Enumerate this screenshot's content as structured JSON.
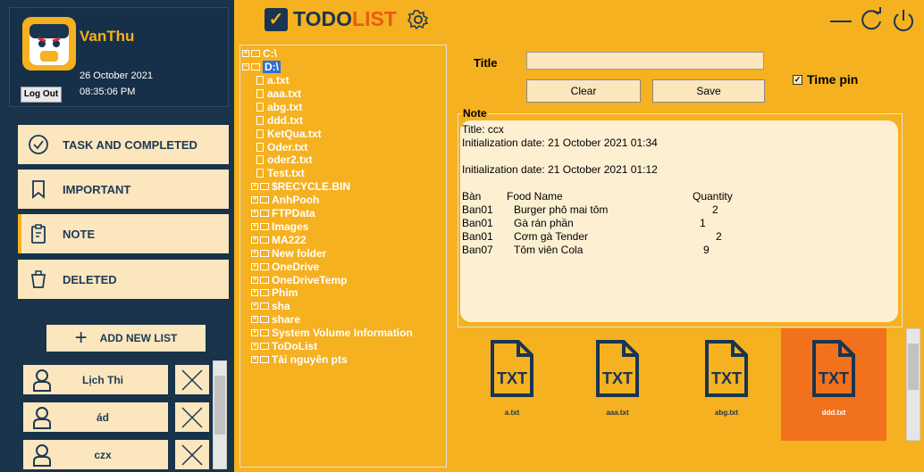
{
  "user": {
    "name": "VanThu",
    "date": "26 October 2021",
    "time": "08:35:06 PM",
    "logout_label": "Log Out"
  },
  "nav": [
    {
      "label": "TASK AND COMPLETED",
      "icon": "check-circle-icon"
    },
    {
      "label": "IMPORTANT",
      "icon": "bookmark-icon"
    },
    {
      "label": "NOTE",
      "icon": "clipboard-icon"
    },
    {
      "label": "DELETED",
      "icon": "trash-icon"
    }
  ],
  "add_list_label": "ADD NEW LIST",
  "lists": [
    {
      "name": "Lịch Thi"
    },
    {
      "name": "ád"
    },
    {
      "name": "czx"
    }
  ],
  "app": {
    "logo_part1": "TODO",
    "logo_part2": "LIST",
    "brand_color": "#f5b120",
    "accent_color": "#f2711c",
    "dark_color": "#1a3550"
  },
  "tree": {
    "c_drive": "C:\\",
    "d_drive": "D:\\",
    "files": [
      "a.txt",
      "aaa.txt",
      "abg.txt",
      "ddd.txt",
      "KetQua.txt",
      "Oder.txt",
      "oder2.txt",
      "Test.txt"
    ],
    "folders": [
      "$RECYCLE.BIN",
      "AnhPooh",
      "FTPData",
      "Images",
      "MA222",
      "New folder",
      "OneDrive",
      "OneDriveTemp",
      "Phim",
      "sha",
      "share",
      "System Volume Information",
      "ToDoList",
      "Tài nguyên pts"
    ]
  },
  "editor": {
    "title_label": "Title",
    "title_value": "",
    "clear_label": "Clear",
    "save_label": "Save",
    "timepin_label": "Time pin",
    "timepin_checked": true,
    "note_label": "Note"
  },
  "note": {
    "title_line": "Title: ccx",
    "init1": "Initialization date: 21 October 2021 01:34",
    "init2": "Initialization date: 21 October 2021 01:12",
    "headers": [
      "Bàn",
      "Food Name",
      "Quantity"
    ],
    "rows": [
      [
        "Ban01",
        "Burger phô mai tôm",
        "2"
      ],
      [
        "Ban01",
        "Gà rán phần",
        "1"
      ],
      [
        "Ban01",
        "Cơm gà Tender",
        "2"
      ],
      [
        "Ban07",
        "Tôm viên Cola",
        "9"
      ]
    ]
  },
  "file_icons": [
    {
      "name": "a.txt",
      "label": "TXT",
      "selected": false
    },
    {
      "name": "aaa.txt",
      "label": "TXT",
      "selected": false
    },
    {
      "name": "abg.txt",
      "label": "TXT",
      "selected": false
    },
    {
      "name": "ddd.txt",
      "label": "TXT",
      "selected": true
    }
  ]
}
